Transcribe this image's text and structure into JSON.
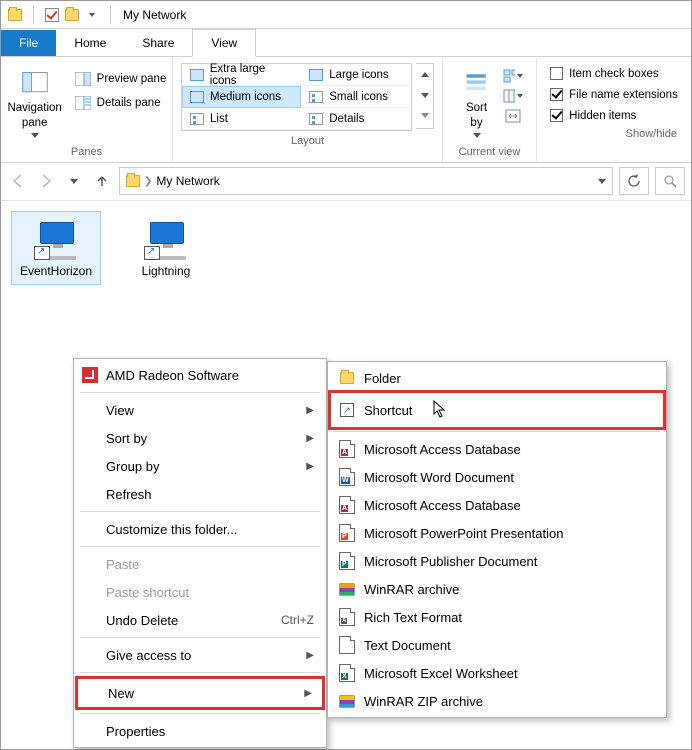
{
  "window": {
    "title": "My Network"
  },
  "tabs": {
    "file": "File",
    "home": "Home",
    "share": "Share",
    "view": "View"
  },
  "ribbon": {
    "navpane": "Navigation\npane",
    "previewpane": "Preview pane",
    "detailspane": "Details pane",
    "layout": {
      "extra_large": "Extra large icons",
      "large": "Large icons",
      "medium": "Medium icons",
      "small": "Small icons",
      "list": "List",
      "details": "Details"
    },
    "sortby": "Sort\nby",
    "item_check": "Item check boxes",
    "filename_ext": "File name extensions",
    "hidden_items": "Hidden items",
    "groups": {
      "panes": "Panes",
      "layout": "Layout",
      "current_view": "Current view",
      "showhide": "Show/hide"
    }
  },
  "address": {
    "path": "My Network"
  },
  "items": {
    "a": "EventHorizon",
    "b": "Lightning"
  },
  "context": {
    "amd": "AMD Radeon Software",
    "view": "View",
    "sortby": "Sort by",
    "groupby": "Group by",
    "refresh": "Refresh",
    "customize": "Customize this folder...",
    "paste": "Paste",
    "paste_shortcut": "Paste shortcut",
    "undo_delete": "Undo Delete",
    "undo_kb": "Ctrl+Z",
    "give_access": "Give access to",
    "new": "New",
    "properties": "Properties"
  },
  "new_submenu": {
    "folder": "Folder",
    "shortcut": "Shortcut",
    "access_db": "Microsoft Access Database",
    "word": "Microsoft Word Document",
    "access_db2": "Microsoft Access Database",
    "ppt": "Microsoft PowerPoint Presentation",
    "publisher": "Microsoft Publisher Document",
    "rar": "WinRAR archive",
    "rtf": "Rich Text Format",
    "txt": "Text Document",
    "excel": "Microsoft Excel Worksheet",
    "zip": "WinRAR ZIP archive"
  }
}
